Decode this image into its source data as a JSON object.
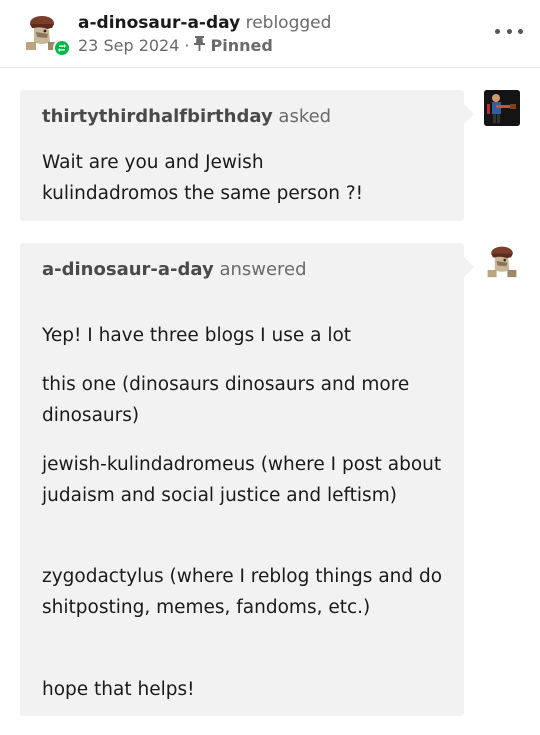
{
  "header": {
    "blog_name": "a-dinosaur-a-day",
    "action": "reblogged",
    "date": "23 Sep 2024",
    "separator": "·",
    "pinned_label": "Pinned"
  },
  "ask": {
    "asker_name": "thirtythirdhalfbirthday",
    "asked_label": "asked",
    "question_line1": "Wait are you and Jewish",
    "question_line2": "kulindadromos the same person ?!"
  },
  "answer": {
    "answerer_name": "a-dinosaur-a-day",
    "answered_label": "answered",
    "paragraphs": [
      "Yep! I have three blogs I use a lot",
      "this one (dinosaurs dinosaurs and more dinosaurs)",
      "jewish-kulindadromeus (where I post about judaism and social justice and leftism)",
      "zygodactylus (where I reblog things and do shitposting, memes, fandoms, etc.)",
      "hope that helps!"
    ]
  },
  "colors": {
    "reblog_green": "#00b84a",
    "bubble_bg": "#f2f2f2",
    "muted_text": "#6a6a6a"
  },
  "icons": {
    "reblog_badge": "reblog-icon",
    "pin": "pin-icon",
    "more": "more-options-icon"
  }
}
